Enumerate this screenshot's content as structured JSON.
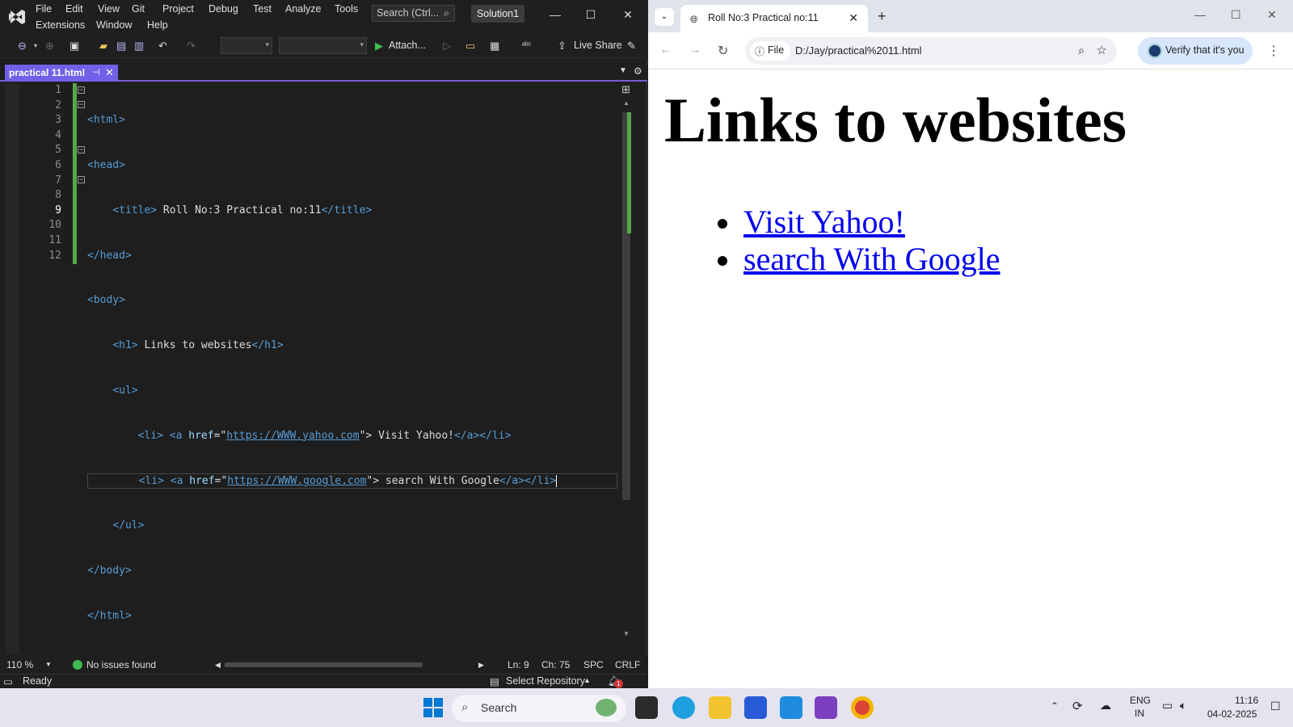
{
  "vs": {
    "menu": [
      "File",
      "Edit",
      "View",
      "Git",
      "Project",
      "Debug",
      "Test",
      "Analyze",
      "Tools",
      "Extensions",
      "Window",
      "Help"
    ],
    "search_text": "Search (Ctrl...",
    "solution": "Solution1",
    "toolbar": {
      "attach": "Attach...",
      "live_share": "Live Share"
    },
    "tab": {
      "title": "practical 11.html"
    },
    "line_numbers": [
      "1",
      "2",
      "3",
      "4",
      "5",
      "6",
      "7",
      "8",
      "9",
      "10",
      "11",
      "12"
    ],
    "code": {
      "l1": "<html>",
      "l2": "<head>",
      "l3_open": "<title>",
      "l3_text": " Roll No:3 Practical no:11",
      "l3_close": "</title>",
      "l4": "</head>",
      "l5": "<body>",
      "l6_open": "<h1>",
      "l6_text": " Links to websites",
      "l6_close": "</h1>",
      "l7": "<ul>",
      "l8_li": "<li>",
      "l8_a": "<a ",
      "l8_attr": "href",
      "l8_eq": "=\"",
      "l8_url": "https://WWW.yahoo.com",
      "l8_q": "\">",
      "l8_text": " Visit Yahoo!",
      "l8_close": "</a></li>",
      "l9_li": "<li>",
      "l9_a": "<a ",
      "l9_attr": "href",
      "l9_eq": "=\"",
      "l9_url": "https://WWW.google.com",
      "l9_q": "\">",
      "l9_text": " search With Google",
      "l9_close": "</a></li>",
      "l10": "</ul>",
      "l11": "</body>",
      "l12": "</html>"
    },
    "status": {
      "zoom": "110 %",
      "issues": "No issues found",
      "ln": "Ln: 9",
      "ch": "Ch: 75",
      "spc": "SPC",
      "crlf": "CRLF",
      "ready": "Ready",
      "repo": "Select Repository",
      "notif_count": "1"
    }
  },
  "browser": {
    "tab_title": "Roll No:3 Practical no:11",
    "chip": "File",
    "url": "D:/Jay/practical%2011.html",
    "verify": "Verify that it's you",
    "page": {
      "h1": "Links to websites",
      "links": [
        "Visit Yahoo!",
        "search With Google"
      ]
    }
  },
  "taskbar": {
    "search": "Search",
    "lang1": "ENG",
    "lang2": "IN",
    "time": "11:16",
    "date": "04-02-2025"
  }
}
